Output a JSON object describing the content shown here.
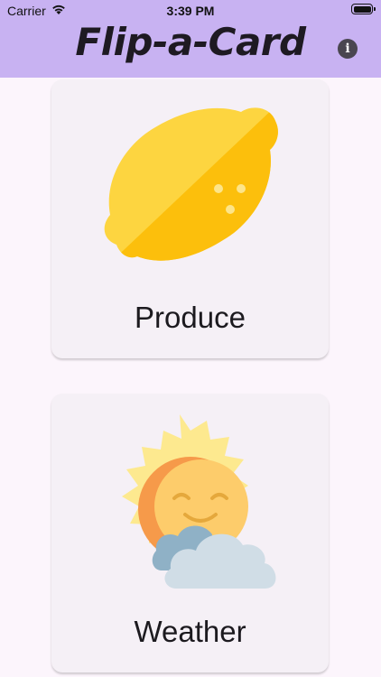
{
  "status_bar": {
    "carrier": "Carrier",
    "time": "3:39 PM"
  },
  "header": {
    "title": "Flip-a-Card",
    "info_icon": "info-icon",
    "background_color": "#c8b2f2"
  },
  "cards": [
    {
      "label": "Produce",
      "icon": "lemon-icon"
    },
    {
      "label": "Weather",
      "icon": "sun-cloud-icon"
    }
  ]
}
